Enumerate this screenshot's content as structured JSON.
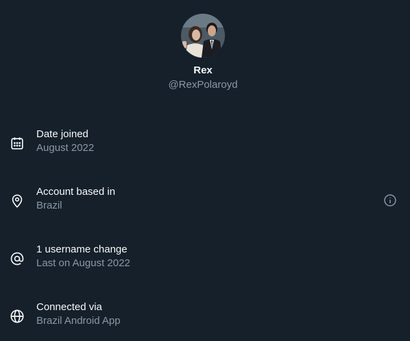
{
  "profile": {
    "name": "Rex",
    "handle": "@RexPolaroyd",
    "avatar_alt": "Profile photo of Rex"
  },
  "details": [
    {
      "icon": "calendar-icon",
      "title": "Date joined",
      "value": "August 2022"
    },
    {
      "icon": "location-pin-icon",
      "title": "Account based in",
      "value": "Brazil",
      "has_info": true
    },
    {
      "icon": "at-sign-icon",
      "title": "1 username change",
      "value": "Last on August 2022"
    },
    {
      "icon": "globe-icon",
      "title": "Connected via",
      "value": "Brazil Android App"
    }
  ],
  "info_button_label": "More information",
  "colors": {
    "background": "#15202b",
    "primary_text": "#f7f9f9",
    "secondary_text": "#8b98a5"
  }
}
